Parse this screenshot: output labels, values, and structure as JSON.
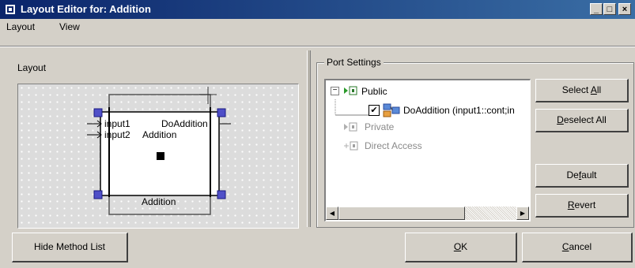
{
  "window": {
    "title": "Layout Editor for: Addition",
    "controls": {
      "minimize": "_",
      "maximize": "□",
      "close": "×"
    }
  },
  "menu": [
    {
      "label": "Layout"
    },
    {
      "label": "View"
    }
  ],
  "layout_panel": {
    "label": "Layout",
    "block": {
      "inputs": [
        "input1",
        "input2"
      ],
      "output": "DoAddition",
      "inner_name": "Addition",
      "caption": "Addition"
    }
  },
  "port_settings": {
    "label": "Port Settings",
    "tree": {
      "public": {
        "expander": "−",
        "label": "Public"
      },
      "method": {
        "checked": true,
        "label": "DoAddition (input1::cont;in"
      },
      "private": {
        "label": "Private"
      },
      "direct_access": {
        "label": "Direct Access"
      }
    },
    "buttons": {
      "select_all": {
        "pre": "Select ",
        "key": "A",
        "post": "ll"
      },
      "deselect_all": {
        "pre": "",
        "key": "D",
        "post": "eselect All"
      },
      "default": {
        "pre": "De",
        "key": "f",
        "post": "ault"
      },
      "revert": {
        "pre": "",
        "key": "R",
        "post": "evert"
      }
    }
  },
  "footer": {
    "hide_method_list": "Hide Method List",
    "ok": {
      "pre": "",
      "key": "O",
      "post": "K"
    },
    "cancel": {
      "pre": "",
      "key": "C",
      "post": "ancel"
    }
  }
}
